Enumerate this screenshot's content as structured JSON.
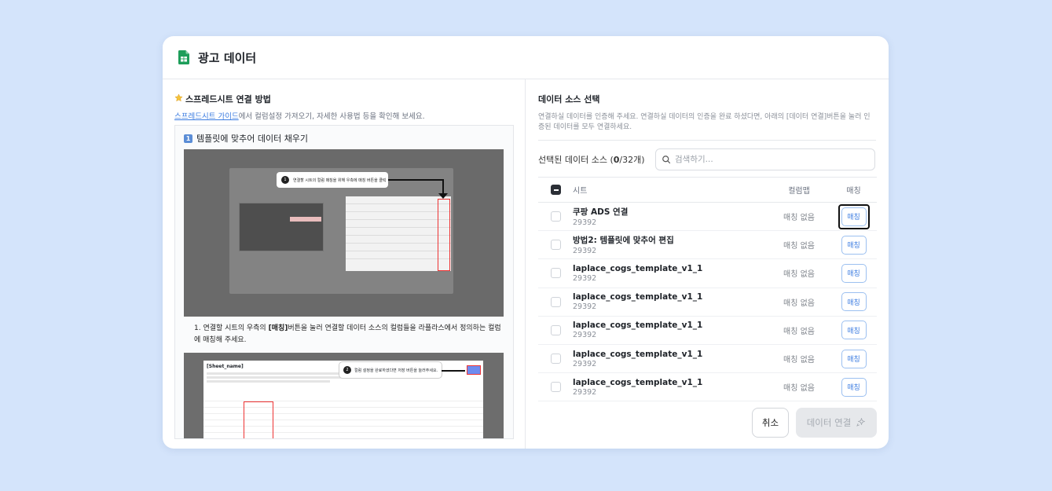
{
  "modal": {
    "title": "광고 데이터",
    "icon": "google-sheets-icon"
  },
  "guide": {
    "title": "스프레드시트 연결 방법",
    "title_icon": "star-icon",
    "link_text": "스프레드시트 가이드",
    "subtitle_rest": "에서 컬럼설정 가져오기, 자세한 사용법 등을 확인해 보세요.",
    "step_badge": "1",
    "step_title": "템플릿에 맞추어 데이터 채우기",
    "screenshot1": {
      "tooltip_number": "1",
      "tooltip_text": "연결할 시트의 컬럼 매칭을 위해 우측에 매칭 버튼을 클릭"
    },
    "step_item_prefix": "1. 연결할 시트의 우측의 ",
    "step_item_bold": "[매칭]",
    "step_item_rest": "버튼을 눌러 연결할 데이터 소스의 컬럼들을 라플라스에서 정의하는 컬럼에 매칭해 주세요.",
    "screenshot2": {
      "sheet_header": "[Sheet_name]",
      "tooltip_number": "2",
      "tooltip_text": "컬럼 설정을 완료하셨다면 저장 버튼을 눌러주세요."
    }
  },
  "datasource": {
    "title": "데이터 소스 선택",
    "description": "연결하실 데이터를 인증해 주세요. 연결하실 데이터의 인증을 완료 하셨다면, 아래의 [데이터 연결]버튼을 눌러 인증된 데이터를 모두 연결하세요.",
    "selected_prefix": "선택된 데이터 소스 (",
    "selected_count": "0",
    "selected_suffix": "/32개)",
    "search_placeholder": "검색하기...",
    "columns": {
      "sheet": "시트",
      "column": "컬럼맵",
      "match": "매칭"
    },
    "rows": [
      {
        "name": "쿠팡 ADS 연결",
        "id": "29392",
        "status": "매칭 없음",
        "action": "매칭",
        "focused": true
      },
      {
        "name": "방법2: 템플릿에 맞추어 편집",
        "id": "29392",
        "status": "매칭 없음",
        "action": "매칭"
      },
      {
        "name": "laplace_cogs_template_v1_1",
        "id": "29392",
        "status": "매칭 없음",
        "action": "매칭"
      },
      {
        "name": "laplace_cogs_template_v1_1",
        "id": "29392",
        "status": "매칭 없음",
        "action": "매칭"
      },
      {
        "name": "laplace_cogs_template_v1_1",
        "id": "29392",
        "status": "매칭 없음",
        "action": "매칭"
      },
      {
        "name": "laplace_cogs_template_v1_1",
        "id": "29392",
        "status": "매칭 없음",
        "action": "매칭"
      },
      {
        "name": "laplace_cogs_template_v1_1",
        "id": "29392",
        "status": "매칭 없음",
        "action": "매칭"
      }
    ]
  },
  "footer": {
    "cancel_label": "취소",
    "connect_label": "데이터 연결",
    "connect_icon": "sparkle-icon"
  },
  "colors": {
    "background": "#d4e4fb",
    "accent": "#3a7be0",
    "sheets_green": "#1e9e5a",
    "disabled_bg": "#e6e8eb"
  }
}
